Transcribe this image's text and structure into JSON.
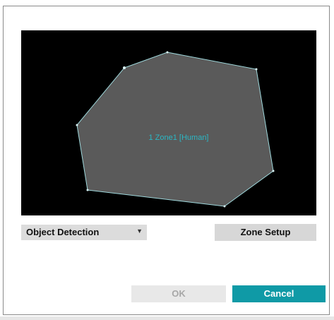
{
  "video": {
    "zone_label": "1 Zone1 [Human]"
  },
  "controls": {
    "mode_select_value": "Object Detection",
    "zone_setup_label": "Zone Setup"
  },
  "footer": {
    "ok_label": "OK",
    "cancel_label": "Cancel"
  },
  "colors": {
    "zone_fill": "#5a5a5a",
    "zone_outline": "#9fd8dc",
    "zone_label_text": "#2bb7c4",
    "cancel_button": "#0f9aa6"
  },
  "icons": {
    "dropdown": "chevron-down-icon"
  }
}
